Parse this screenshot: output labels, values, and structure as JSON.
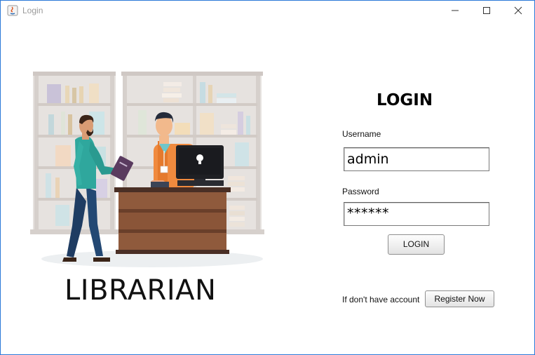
{
  "window": {
    "title": "Login",
    "controls": {
      "minimize_icon": "minimize-icon",
      "maximize_icon": "maximize-icon",
      "close_icon": "close-icon"
    },
    "accent_border": "#2b79d8"
  },
  "branding": {
    "text": "LIBRARIAN"
  },
  "form": {
    "heading": "LOGIN",
    "username_label": "Username",
    "username_value": "admin",
    "password_label": "Password",
    "password_value": "******",
    "login_button": "LOGIN"
  },
  "footer": {
    "no_account_text": "If don't have account",
    "register_button": "Register Now"
  }
}
